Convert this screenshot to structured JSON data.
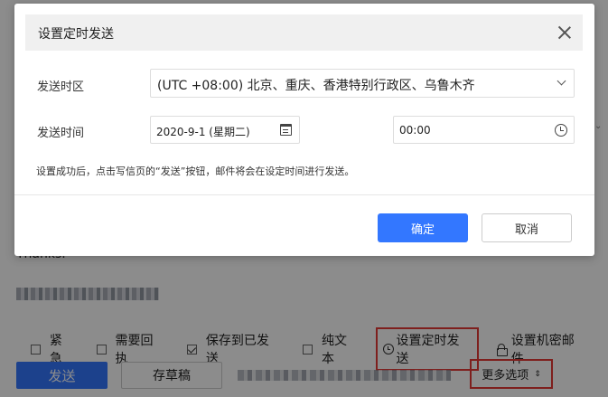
{
  "dialog": {
    "title": "设置定时发送",
    "timezone_label": "发送时区",
    "timezone_value": "(UTC +08:00) 北京、重庆、香港特别行政区、乌鲁木齐",
    "time_label": "发送时间",
    "date_value": "2020-9-1 (星期二)",
    "time_value": "00:00",
    "hint": "设置成功后，点击写信页的“发送”按钮，邮件将会在设定时间进行发送。",
    "confirm_label": "确定",
    "cancel_label": "取消"
  },
  "compose": {
    "body_text": "Thanks.",
    "options": {
      "urgent": "紧急",
      "receipt": "需要回执",
      "save_sent": "保存到已发送",
      "plain_text": "纯文本",
      "timed_send": "设置定时发送",
      "confidential": "设置机密邮件"
    },
    "send_label": "发送",
    "draft_label": "存草稿",
    "more_options_label": "更多选项"
  },
  "colors": {
    "primary": "#3377ff",
    "highlight": "#e53935"
  }
}
